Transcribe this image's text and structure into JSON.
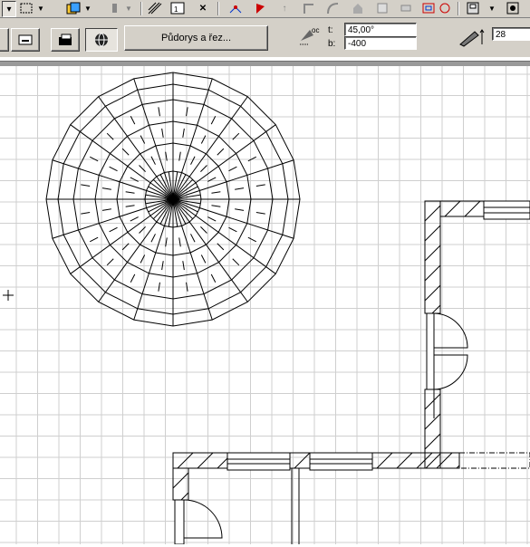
{
  "toolbar": {
    "icons": [
      "fill-arrow-icon",
      "pattern-icon",
      "color-box-icon",
      "pen-icon",
      "hatch-icon",
      "layout-icon",
      "close-x-icon",
      "flag-icon",
      "magic-icon",
      "arrow-up-icon",
      "corner-icon",
      "arc-icon",
      "house-icon",
      "door-icon",
      "eraser-icon",
      "frame-icon",
      "window-icon",
      "save-icon"
    ]
  },
  "view": {
    "button_label": "Půdorys a řez..."
  },
  "params": {
    "t_label": "t:",
    "t_value": "45,00°",
    "b_label": "b:",
    "b_value": "-400",
    "right_value": "28"
  },
  "drawing": {
    "description_icons": [
      "cursor-crosshair-icon"
    ]
  }
}
